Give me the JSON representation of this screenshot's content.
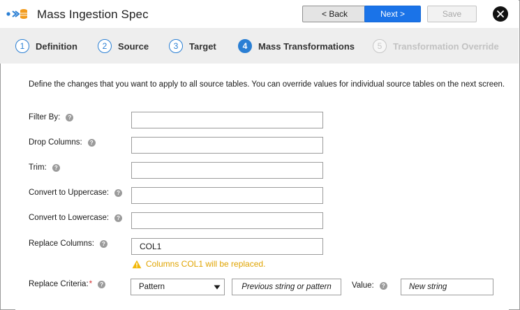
{
  "header": {
    "title": "Mass Ingestion Spec",
    "icon": "mass-ingestion-icon",
    "back_label": "< Back",
    "next_label": "Next >",
    "save_label": "Save",
    "close_icon": "close-icon",
    "colors": {
      "accent": "#1a73e8",
      "step_accent": "#2a7fd4"
    }
  },
  "steps": [
    {
      "num": "1",
      "label": "Definition",
      "state": "done"
    },
    {
      "num": "2",
      "label": "Source",
      "state": "done"
    },
    {
      "num": "3",
      "label": "Target",
      "state": "done"
    },
    {
      "num": "4",
      "label": "Mass Transformations",
      "state": "active"
    },
    {
      "num": "5",
      "label": "Transformation Override",
      "state": "disabled"
    }
  ],
  "main": {
    "description": "Define the changes that you want to apply to all source tables. You can override values for individual source tables on the next screen.",
    "fields": {
      "filter_by": {
        "label": "Filter By:",
        "value": ""
      },
      "drop_columns": {
        "label": "Drop Columns:",
        "value": ""
      },
      "trim": {
        "label": "Trim:",
        "value": ""
      },
      "uppercase": {
        "label": "Convert to Uppercase:",
        "value": ""
      },
      "lowercase": {
        "label": "Convert to Lowercase:",
        "value": ""
      },
      "replace_columns": {
        "label": "Replace Columns:",
        "value": "COL1"
      }
    },
    "warning": "Columns COL1 will be replaced.",
    "replace_criteria": {
      "label": "Replace Criteria:",
      "required_mark": "*",
      "selected": "Pattern",
      "pattern_button": "Previous string or pattern",
      "value_label": "Value:",
      "value_placeholder": "New string"
    },
    "help_glyph": "?"
  }
}
